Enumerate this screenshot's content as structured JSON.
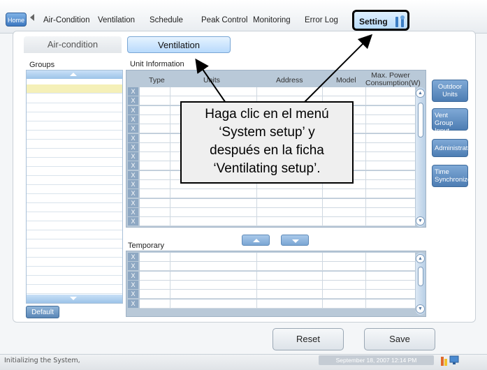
{
  "top_tabs": {
    "home": "Home",
    "items": [
      "Air-Condition",
      "Ventilation",
      "Schedule",
      "Peak Control",
      "Monitoring",
      "Error Log"
    ],
    "active": "Setting"
  },
  "sub_tabs": {
    "air": "Air-condition",
    "vent": "Ventilation"
  },
  "groups": {
    "label": "Groups",
    "default_button": "Default"
  },
  "unit_info": {
    "label": "Unit Information",
    "columns": [
      "Type",
      "Units",
      "Address",
      "Model",
      "Max. Power Consumption(W)"
    ],
    "row_count": 15,
    "delete_glyph": "X"
  },
  "temporary": {
    "label": "Temporary",
    "row_count": 6
  },
  "side_buttons": [
    "Outdoor Units",
    "Vent Group Input",
    "Administrator",
    "Time Synchronize"
  ],
  "bottom_buttons": {
    "reset": "Reset",
    "save": "Save"
  },
  "status": {
    "message": "Initializing the System,",
    "datetime": "September 18, 2007 12:14 PM"
  },
  "callout": {
    "line1": "Haga clic en el menú",
    "line2": "‘System setup’ y",
    "line3": "después en la ficha",
    "line4": "‘Ventilating setup’."
  },
  "colors": {
    "accent": "#4d7db3",
    "table_header": "#b9c9d8",
    "selected_row": "#f5f0b8",
    "highlight": "#000000"
  }
}
